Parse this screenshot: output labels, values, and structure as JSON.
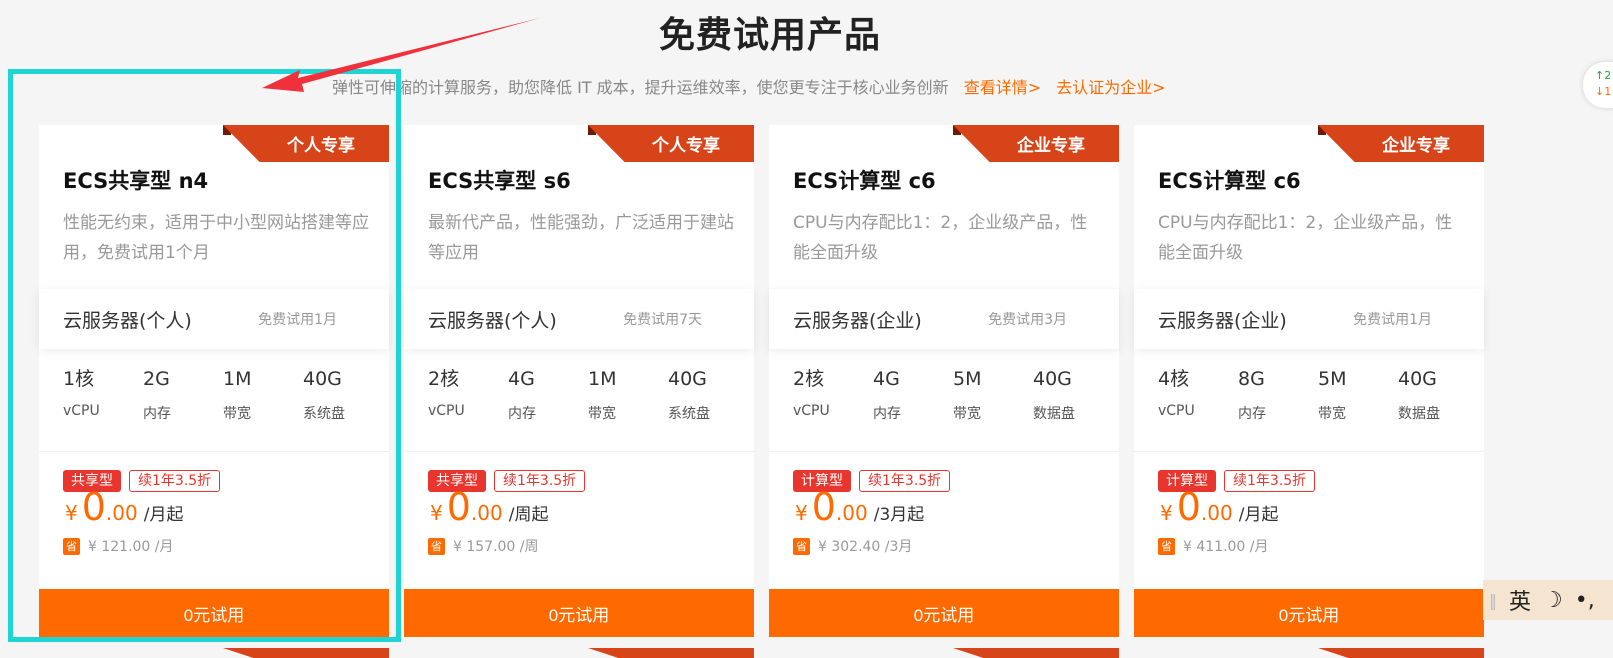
{
  "header": {
    "title": "免费试用产品",
    "subtitle": "弹性可伸缩的计算服务，助您降低 IT 成本，提升运维效率，使您更专注于核心业务创新",
    "link_details": "查看详情>",
    "link_enterprise": "去认证为企业>"
  },
  "colors": {
    "accent": "#ff6a00",
    "ribbon": "#d8441a",
    "tag": "#e8352d",
    "highlight": "#1ed4d4",
    "arrow": "#f0303a"
  },
  "cards": [
    {
      "ribbon": "个人专享",
      "title": "ECS共享型 n4",
      "desc": "性能无约束，适用于中小型网站搭建等应用，免费试用1个月",
      "plan_name": "云服务器(个人)",
      "plan_trial": "免费试用1月",
      "specs": [
        {
          "value": "1核",
          "unit": "vCPU"
        },
        {
          "value": "2G",
          "unit": "内存"
        },
        {
          "value": "1M",
          "unit": "带宽"
        },
        {
          "value": "40G",
          "unit": "系统盘"
        }
      ],
      "tag_type": "共享型",
      "tag_renew": "续1年3.5折",
      "price_yen": "¥",
      "price_int": "0",
      "price_dec": ".00",
      "price_period": "/月起",
      "save_icon": "省",
      "orig_price": "¥ 121.00 /月",
      "button": "0元试用"
    },
    {
      "ribbon": "个人专享",
      "title": "ECS共享型 s6",
      "desc": "最新代产品，性能强劲，广泛适用于建站等应用",
      "plan_name": "云服务器(个人)",
      "plan_trial": "免费试用7天",
      "specs": [
        {
          "value": "2核",
          "unit": "vCPU"
        },
        {
          "value": "4G",
          "unit": "内存"
        },
        {
          "value": "1M",
          "unit": "带宽"
        },
        {
          "value": "40G",
          "unit": "系统盘"
        }
      ],
      "tag_type": "共享型",
      "tag_renew": "续1年3.5折",
      "price_yen": "¥",
      "price_int": "0",
      "price_dec": ".00",
      "price_period": "/周起",
      "save_icon": "省",
      "orig_price": "¥ 157.00 /周",
      "button": "0元试用"
    },
    {
      "ribbon": "企业专享",
      "title": "ECS计算型 c6",
      "desc": "CPU与内存配比1：2，企业级产品，性能全面升级",
      "plan_name": "云服务器(企业)",
      "plan_trial": "免费试用3月",
      "specs": [
        {
          "value": "2核",
          "unit": "vCPU"
        },
        {
          "value": "4G",
          "unit": "内存"
        },
        {
          "value": "5M",
          "unit": "带宽"
        },
        {
          "value": "40G",
          "unit": "数据盘"
        }
      ],
      "tag_type": "计算型",
      "tag_renew": "续1年3.5折",
      "price_yen": "¥",
      "price_int": "0",
      "price_dec": ".00",
      "price_period": "/3月起",
      "save_icon": "省",
      "orig_price": "¥ 302.40 /3月",
      "button": "0元试用"
    },
    {
      "ribbon": "企业专享",
      "title": "ECS计算型 c6",
      "desc": "CPU与内存配比1：2，企业级产品，性能全面升级",
      "plan_name": "云服务器(企业)",
      "plan_trial": "免费试用1月",
      "specs": [
        {
          "value": "4核",
          "unit": "vCPU"
        },
        {
          "value": "8G",
          "unit": "内存"
        },
        {
          "value": "5M",
          "unit": "带宽"
        },
        {
          "value": "40G",
          "unit": "数据盘"
        }
      ],
      "tag_type": "计算型",
      "tag_renew": "续1年3.5折",
      "price_yen": "¥",
      "price_int": "0",
      "price_dec": ".00",
      "price_period": "/月起",
      "save_icon": "省",
      "orig_price": "¥ 411.00 /月",
      "button": "0元试用"
    }
  ],
  "side_widget": {
    "up": "↑2",
    "down": "↓1"
  },
  "ime": {
    "lang": "英",
    "moon_icon": "☽",
    "punct": "•,"
  }
}
